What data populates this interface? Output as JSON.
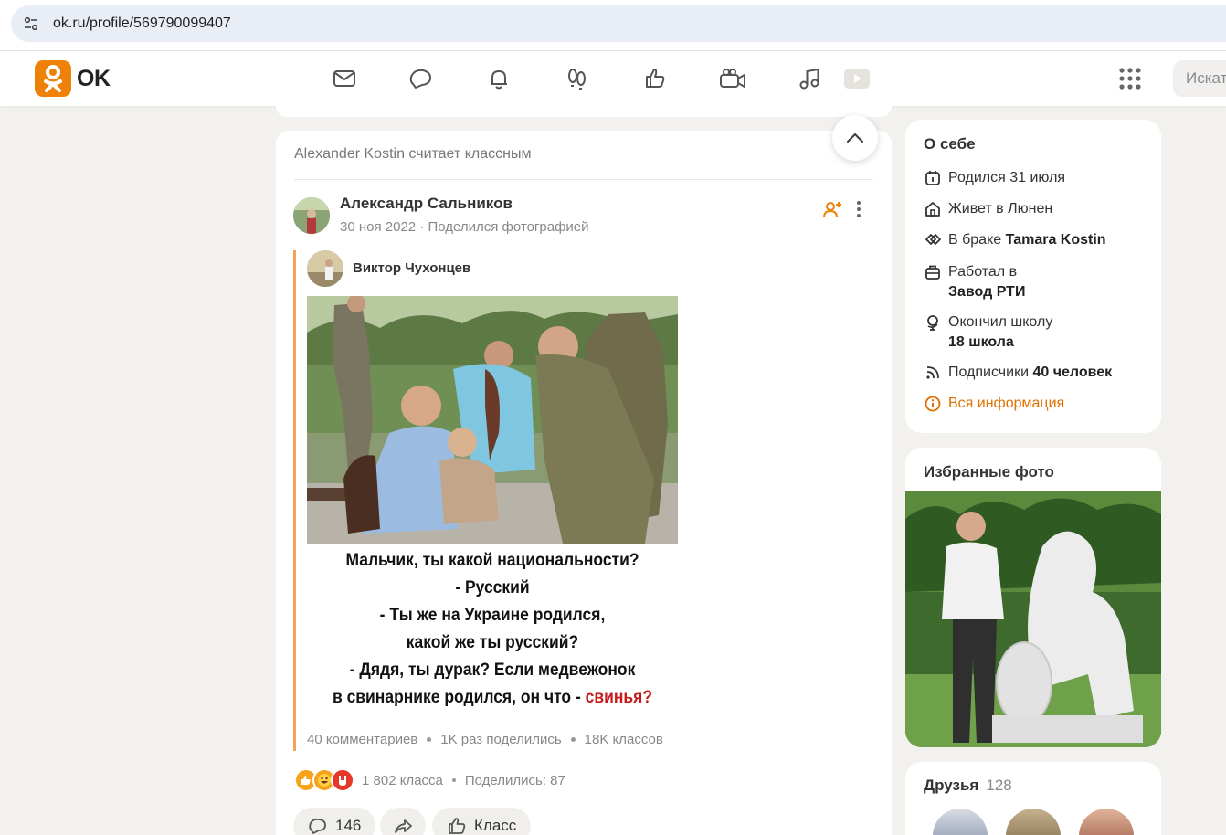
{
  "browser": {
    "url": "ok.ru/profile/569790099407",
    "tune_icon": "site-settings-icon"
  },
  "header": {
    "logo_text": "OK",
    "nav_icons": [
      "messages-icon",
      "discussions-icon",
      "notifications-icon",
      "guests-icon",
      "likes-icon",
      "video-calls-icon",
      "music-icon",
      "video-icon"
    ],
    "search_placeholder": "Искать",
    "brand_color": "#ee8208"
  },
  "feed": {
    "header": "Alexander Kostin считает классным",
    "post": {
      "author": "Александр Сальников",
      "meta": "30 ноя 2022 · Поделился фотографией",
      "reposted_from": "Виктор Чухонцев",
      "meme_caption_lines": [
        "Мальчик, ты какой национальности?",
        "- Русский",
        "- Ты же на Украине родился,",
        "какой же ты русский?",
        "- Дядя, ты дурак? Если медвежонок",
        "в свинарнике родился, он что -"
      ],
      "meme_caption_red": "свинья?",
      "repost_stats": {
        "comments": "40 комментариев",
        "shares": "1K раз поделились",
        "likes": "18K классов"
      },
      "reactions_count": "1 802 класса",
      "shared": "Поделились: 87",
      "actions": {
        "comments": "146",
        "like_label": "Класс"
      }
    }
  },
  "about": {
    "title": "О себе",
    "born": "Родился 31 июля",
    "lives": "Живет в Люнен",
    "married_prefix": "В браке",
    "married_name": "Tamara Kostin",
    "worked_prefix": "Работал в",
    "worked_place": "Завод РТИ",
    "school_prefix": "Окончил школу",
    "school_name": "18 школа",
    "subs_prefix": "Подписчики",
    "subs_count": "40 человек",
    "all_info": "Вся информация"
  },
  "favorites": {
    "title": "Избранные фото"
  },
  "friends": {
    "title": "Друзья",
    "count": "128"
  }
}
